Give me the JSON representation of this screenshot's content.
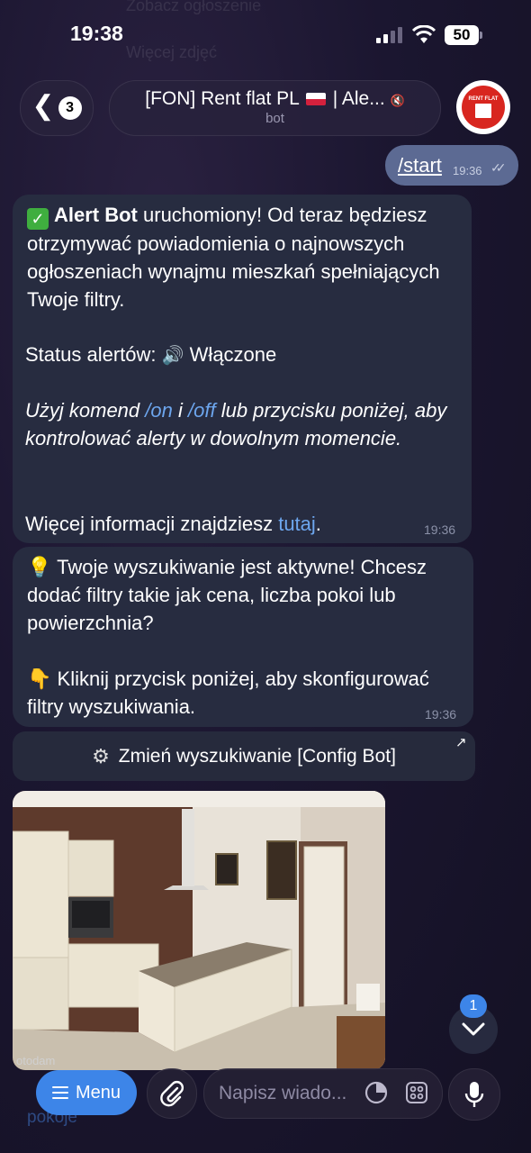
{
  "status_bar": {
    "time": "19:38",
    "battery": "50"
  },
  "background_ghosts": {
    "line1": "Zobacz ogłoszenie",
    "line2": "Więcej zdjęć",
    "bottom_text": "pokoje"
  },
  "header": {
    "back_count": "3",
    "title_prefix": "[FON] Rent flat PL",
    "title_suffix": "| Ale...",
    "subtitle": "bot",
    "avatar_brand": "RENT FLAT"
  },
  "outgoing": {
    "text": "/start",
    "time": "19:36"
  },
  "message1": {
    "bold": "Alert Bot",
    "intro": " uruchomiony! Od teraz będziesz otrzymywać powiadomienia o najnowszych ogłoszeniach wynajmu mieszkań spełniających Twoje filtry.",
    "status_label": "Status alertów:",
    "status_value": "Włączone",
    "hint_a": "Użyj komend ",
    "cmd_on": "/on",
    "hint_b": " i ",
    "cmd_off": "/off",
    "hint_c": " lub przycisku poniżej, aby kontrolować alerty w dowolnym momencie.",
    "more_a": "Więcej informacji znajdziesz ",
    "more_link": "tutaj",
    "more_b": ".",
    "time": "19:36"
  },
  "message2": {
    "para1": "Twoje wyszukiwanie jest aktywne! Chcesz dodać filtry takie jak cena, liczba pokoi lub powierzchnia?",
    "para2": "Kliknij przycisk poniżej, aby skonfigurować filtry wyszukiwania.",
    "time": "19:36"
  },
  "config_button": {
    "label": "Zmień wyszukiwanie [Config Bot]"
  },
  "photo": {
    "caption": "otodam"
  },
  "scroll": {
    "unread": "1"
  },
  "composer": {
    "menu_label": "Menu",
    "placeholder": "Napisz wiado..."
  }
}
